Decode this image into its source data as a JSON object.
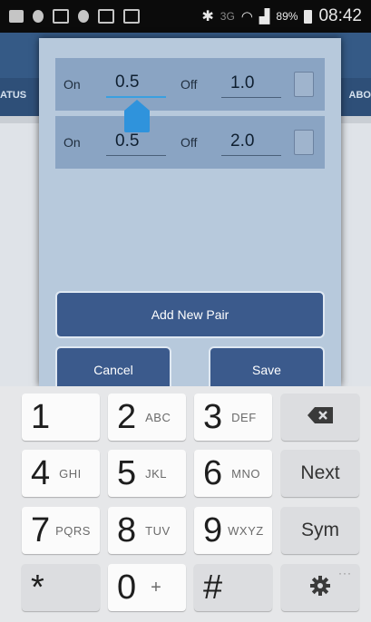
{
  "status_bar": {
    "battery_percent": "89%",
    "time": "08:42",
    "network_label": "3G"
  },
  "background_app": {
    "tab_left_fragment": "ATUS",
    "tab_right_fragment": "ABO"
  },
  "dialog": {
    "pairs": [
      {
        "on_label": "On",
        "on_value": "0.5",
        "off_label": "Off",
        "off_value": "1.0",
        "checked": false
      },
      {
        "on_label": "On",
        "on_value": "0.5",
        "off_label": "Off",
        "off_value": "2.0",
        "checked": false
      }
    ],
    "add_button": "Add New Pair",
    "cancel_button": "Cancel",
    "save_button": "Save"
  },
  "keyboard": {
    "rows": [
      [
        {
          "digit": "1",
          "letters": ""
        },
        {
          "digit": "2",
          "letters": "ABC"
        },
        {
          "digit": "3",
          "letters": "DEF"
        }
      ],
      [
        {
          "digit": "4",
          "letters": "GHI"
        },
        {
          "digit": "5",
          "letters": "JKL"
        },
        {
          "digit": "6",
          "letters": "MNO"
        }
      ],
      [
        {
          "digit": "7",
          "letters": "PQRS"
        },
        {
          "digit": "8",
          "letters": "TUV"
        },
        {
          "digit": "9",
          "letters": "WXYZ"
        }
      ],
      [
        {
          "digit": "*",
          "letters": ""
        },
        {
          "digit": "0",
          "letters": "+"
        },
        {
          "digit": "#",
          "letters": ""
        }
      ]
    ],
    "next_label": "Next",
    "sym_label": "Sym",
    "dots_label": "···",
    "backspace_icon": "backspace-icon",
    "settings_icon": "gear-icon"
  },
  "colors": {
    "dialog_bg": "#b7c9dc",
    "row_bg": "#8aa4c3",
    "button_bg": "#3b5a8c",
    "accent": "#3aa0e0"
  }
}
